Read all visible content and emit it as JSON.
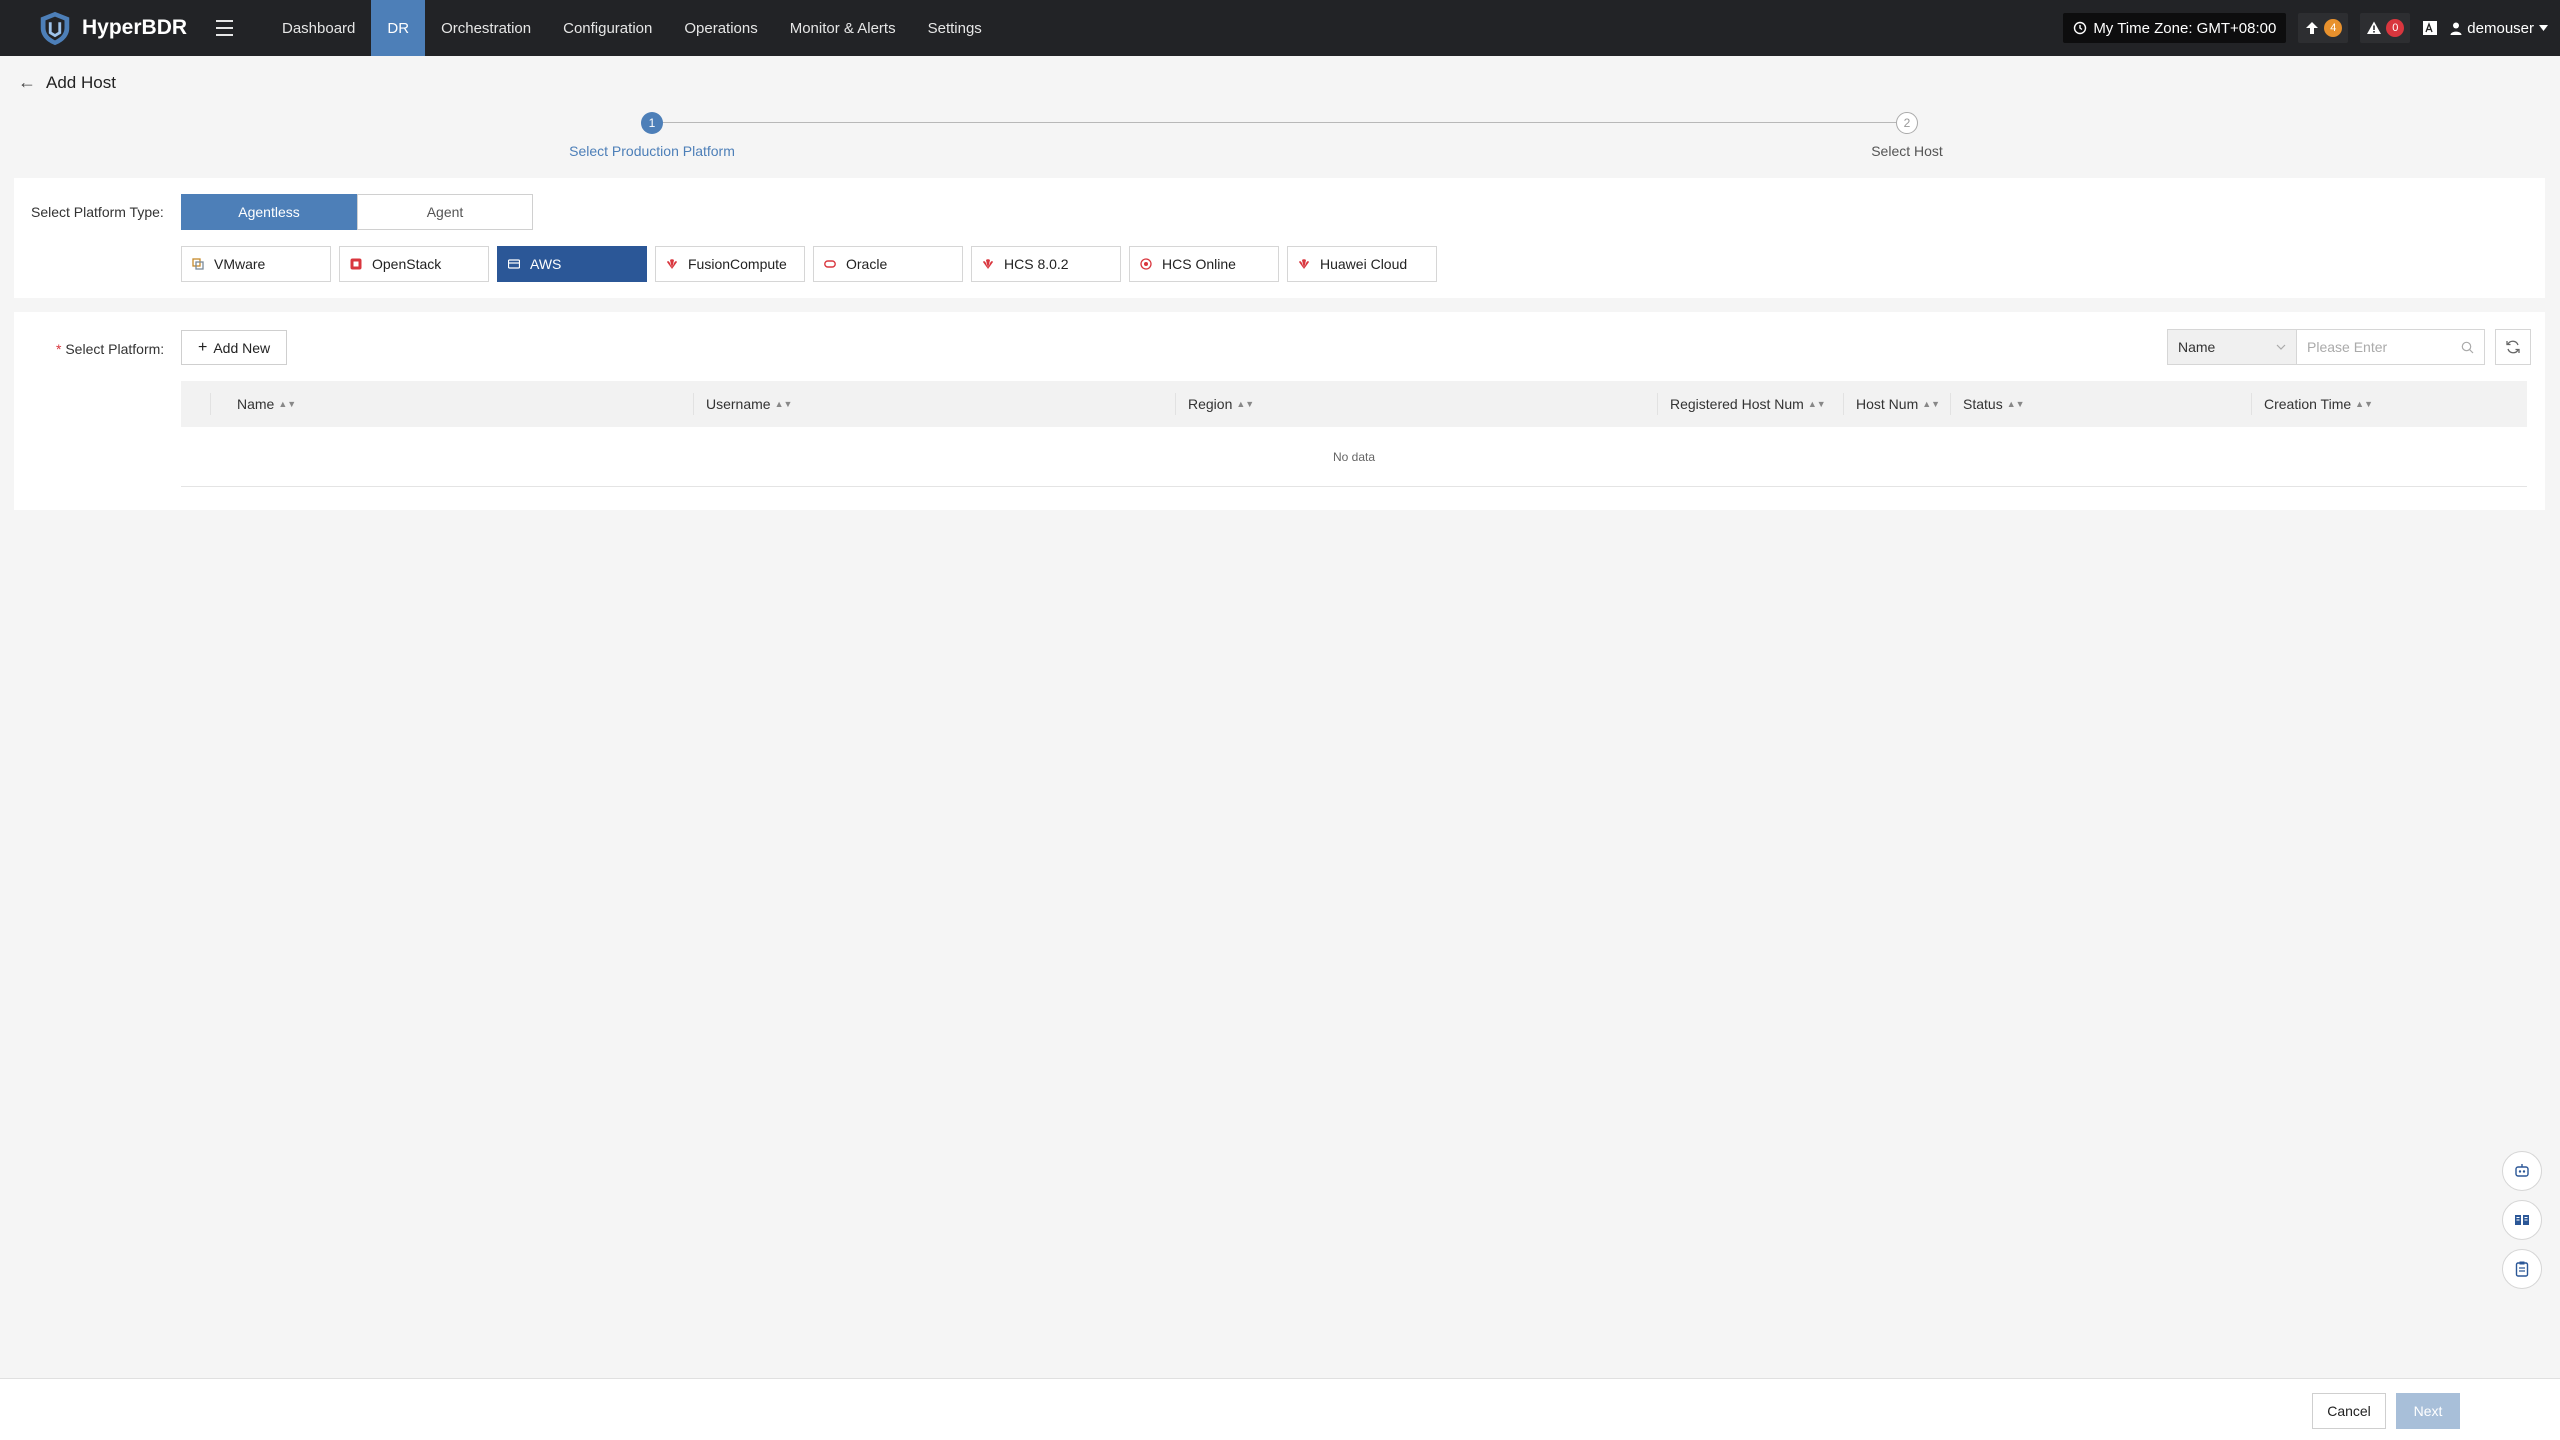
{
  "app": {
    "name": "HyperBDR"
  },
  "nav": {
    "items": [
      {
        "label": "Dashboard",
        "active": false
      },
      {
        "label": "DR",
        "active": true
      },
      {
        "label": "Orchestration",
        "active": false
      },
      {
        "label": "Configuration",
        "active": false
      },
      {
        "label": "Operations",
        "active": false
      },
      {
        "label": "Monitor & Alerts",
        "active": false
      },
      {
        "label": "Settings",
        "active": false
      }
    ],
    "timezone": "My Time Zone: GMT+08:00",
    "upgrade_count": "4",
    "alert_count": "0",
    "username": "demouser"
  },
  "page": {
    "title": "Add Host"
  },
  "steps": [
    {
      "number": "1",
      "label": "Select Production Platform",
      "active": true
    },
    {
      "number": "2",
      "label": "Select Host",
      "active": false
    }
  ],
  "platform_type": {
    "label": "Select Platform Type:",
    "options": [
      "Agentless",
      "Agent"
    ],
    "selected": "Agentless"
  },
  "platforms": {
    "options": [
      {
        "label": "VMware",
        "icon": "vmware-icon",
        "color": "#c58a2b"
      },
      {
        "label": "OpenStack",
        "icon": "openstack-icon",
        "color": "#d9363e"
      },
      {
        "label": "AWS",
        "icon": "aws-icon",
        "color": "#ffffff"
      },
      {
        "label": "FusionCompute",
        "icon": "huawei-icon",
        "color": "#d9363e"
      },
      {
        "label": "Oracle",
        "icon": "oracle-icon",
        "color": "#d9363e"
      },
      {
        "label": "HCS 8.0.2",
        "icon": "huawei-icon",
        "color": "#d9363e"
      },
      {
        "label": "HCS Online",
        "icon": "hcs-online-icon",
        "color": "#d9363e"
      },
      {
        "label": "Huawei Cloud",
        "icon": "huawei-icon",
        "color": "#d9363e"
      }
    ],
    "selected": "AWS"
  },
  "platform_list": {
    "label": "Select Platform:",
    "required_mark": "*",
    "add_new_label": "Add New",
    "search_field": "Name",
    "search_placeholder": "Please Enter",
    "columns": [
      "Name",
      "Username",
      "Region",
      "Registered Host Num",
      "Host Num",
      "Status",
      "Creation Time"
    ],
    "empty_text": "No data"
  },
  "footer": {
    "cancel_label": "Cancel",
    "next_label": "Next"
  },
  "colors": {
    "primary": "#4d7fb8",
    "selected_platform": "#2b5797",
    "nav_bg": "#222326"
  }
}
